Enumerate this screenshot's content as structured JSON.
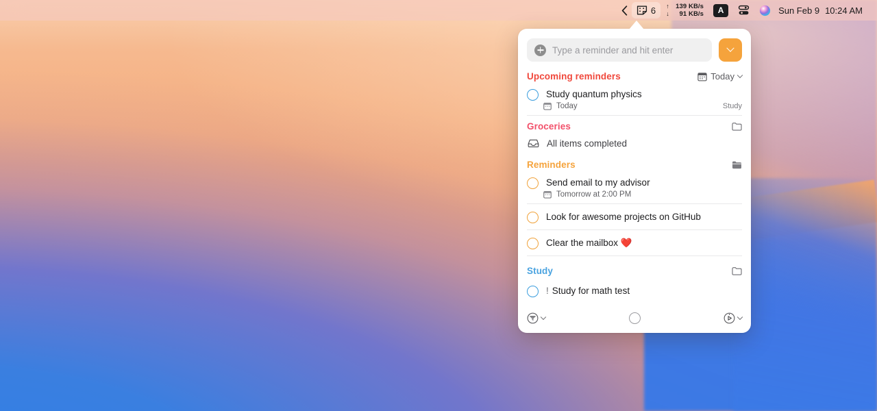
{
  "menubar": {
    "back_icon": "chevron-left-icon",
    "reminders_icon": "sticky-note-icon",
    "reminders_count": "6",
    "network": {
      "up_arrow": "↑",
      "up_value": "139 KB/s",
      "down_arrow": "↓",
      "down_value": "91 KB/s"
    },
    "input_source": "A",
    "control_center_icon": "control-center-icon",
    "siri_icon": "siri-icon",
    "date": "Sun Feb 9",
    "time": "10:24 AM"
  },
  "popover": {
    "search": {
      "placeholder": "Type a reminder and hit enter",
      "value": "",
      "add_icon": "plus-circle-icon",
      "dropdown_icon": "chevron-down-icon"
    },
    "sections": [
      {
        "title": "Upcoming reminders",
        "color": "#f0483c",
        "right_label": "Today",
        "right_icon": "calendar-icon",
        "right_chevron": "chevron-down-icon",
        "items": [
          {
            "title": "Study quantum physics",
            "circle_color": "blue",
            "priority": "",
            "date_icon": "calendar-icon",
            "date": "Today",
            "list": "Study"
          }
        ]
      },
      {
        "title": "Groceries",
        "color": "#f2506a",
        "right_icon": "folder-outline-icon",
        "empty_icon": "tray-icon",
        "empty_text": "All items completed",
        "items": []
      },
      {
        "title": "Reminders",
        "color": "#f5a33c",
        "right_icon": "folder-filled-icon",
        "items": [
          {
            "title": "Send email to my advisor",
            "circle_color": "orange",
            "priority": "",
            "date_icon": "calendar-icon",
            "date": "Tomorrow at 2:00 PM",
            "list": ""
          },
          {
            "title": "Look for awesome projects on GitHub",
            "circle_color": "orange",
            "priority": "",
            "date": "",
            "list": ""
          },
          {
            "title": "Clear the mailbox ❤️",
            "circle_color": "orange",
            "priority": "",
            "date": "",
            "list": ""
          }
        ]
      },
      {
        "title": "Study",
        "color": "#4aa3e0",
        "right_icon": "folder-outline-icon",
        "items": [
          {
            "title": "Study for math test",
            "circle_color": "blue",
            "priority": "!",
            "date": "",
            "list": ""
          }
        ]
      }
    ],
    "footer": {
      "filter_icon": "filter-circle-icon",
      "filter_chevron": "chevron-down-icon",
      "add_icon": "circle-outline-icon",
      "timer_icon": "timer-circle-icon",
      "timer_chevron": "chevron-down-icon"
    }
  }
}
